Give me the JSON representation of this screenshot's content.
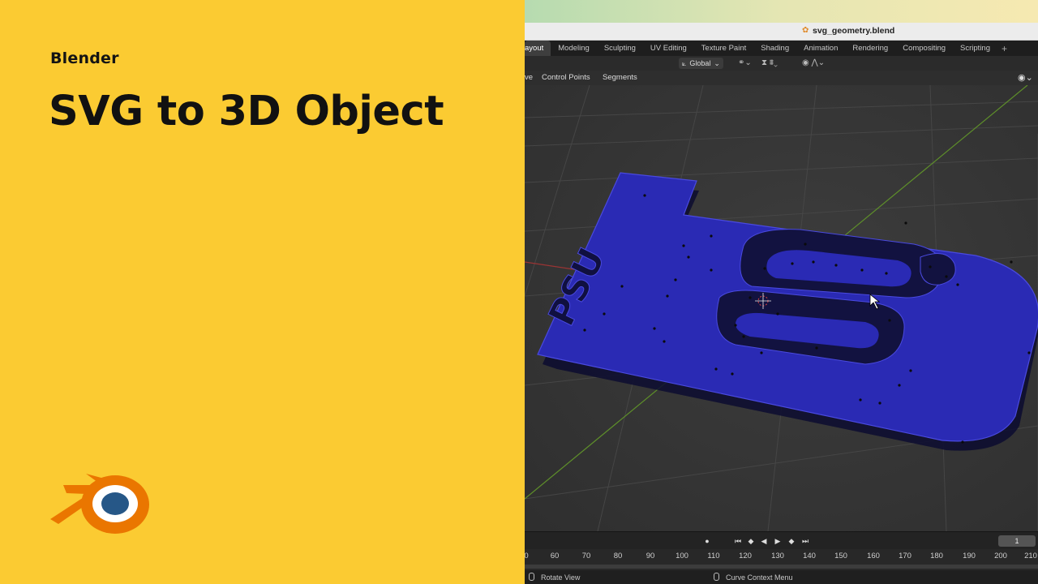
{
  "thumbnail": {
    "brand": "Blender",
    "title": "SVG to 3D Object",
    "logo_colors": {
      "orange": "#ea7600",
      "blue": "#265787",
      "white": "#ffffff"
    }
  },
  "window": {
    "file_name": "svg_geometry.blend"
  },
  "workspace_tabs": [
    "ayout",
    "Modeling",
    "Sculpting",
    "UV Editing",
    "Texture Paint",
    "Shading",
    "Animation",
    "Rendering",
    "Compositing",
    "Scripting"
  ],
  "workspace_add": "+",
  "tool_header": {
    "orientation": "Global"
  },
  "viewport_header": {
    "menu_partial": "ve",
    "menu_control_points": "Control Points",
    "menu_segments": "Segments"
  },
  "viewport": {
    "object_text": "PSU",
    "object_color": "#2a2ab4"
  },
  "timeline": {
    "current_frame": "1",
    "ticks": [
      "0",
      "60",
      "70",
      "80",
      "90",
      "100",
      "110",
      "120",
      "130",
      "140",
      "150",
      "160",
      "170",
      "180",
      "190",
      "200",
      "210"
    ]
  },
  "statusbar": {
    "left": "Rotate View",
    "right": "Curve Context Menu"
  }
}
